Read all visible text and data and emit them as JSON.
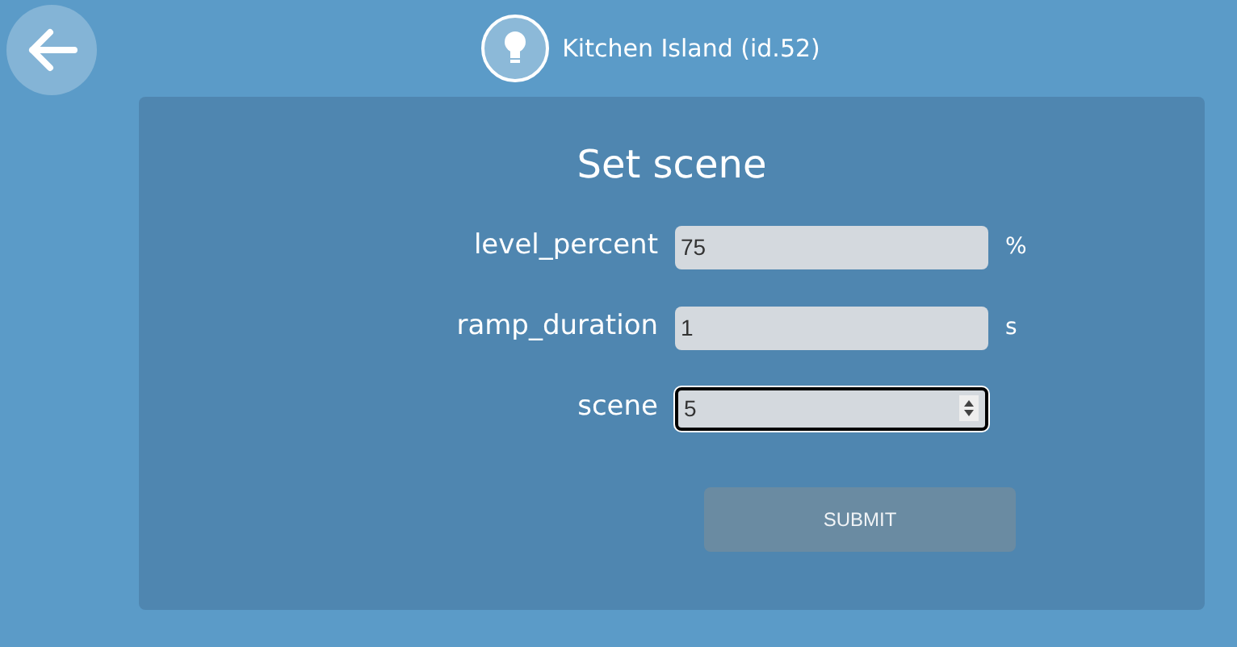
{
  "header": {
    "title": "Kitchen Island (id.52)"
  },
  "form": {
    "title": "Set scene",
    "fields": [
      {
        "kind": "text",
        "label": "level_percent",
        "value": "75",
        "unit": "%",
        "focused": false
      },
      {
        "kind": "text",
        "label": "ramp_duration",
        "value": "1",
        "unit": "s",
        "focused": false
      },
      {
        "kind": "number",
        "label": "scene",
        "value": "5",
        "focused": true
      }
    ],
    "submit": {
      "label": "SUBMIT",
      "disabled": true
    }
  }
}
